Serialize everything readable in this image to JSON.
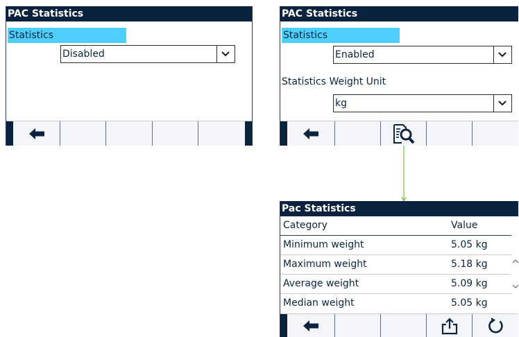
{
  "screen_disabled": {
    "title": "PAC Statistics",
    "statistics_label": "Statistics",
    "statistics_value": "Disabled"
  },
  "screen_enabled": {
    "title": "PAC Statistics",
    "statistics_label": "Statistics",
    "statistics_value": "Enabled",
    "unit_label": "Statistics Weight Unit",
    "unit_value": "kg"
  },
  "screen_table": {
    "title": "Pac Statistics",
    "columns": [
      "Category",
      "Value"
    ],
    "rows": [
      {
        "category": "Minimum weight",
        "value": "5.05 kg"
      },
      {
        "category": "Maximum weight",
        "value": "5.18 kg"
      },
      {
        "category": "Average weight",
        "value": "5.09 kg"
      },
      {
        "category": "Median weight",
        "value": "5.05 kg"
      }
    ]
  },
  "icons": {
    "back": "left-arrow-icon",
    "view": "magnifier-report-icon",
    "export": "export-icon",
    "reset": "reset-icon",
    "dropdown": "chevron-down-icon",
    "scroll_up": "scroll-up-icon",
    "scroll_down": "scroll-down-icon"
  },
  "colors": {
    "titlebar": "#0c2340",
    "highlight": "#4dcffc",
    "connector": "#7ac043"
  }
}
